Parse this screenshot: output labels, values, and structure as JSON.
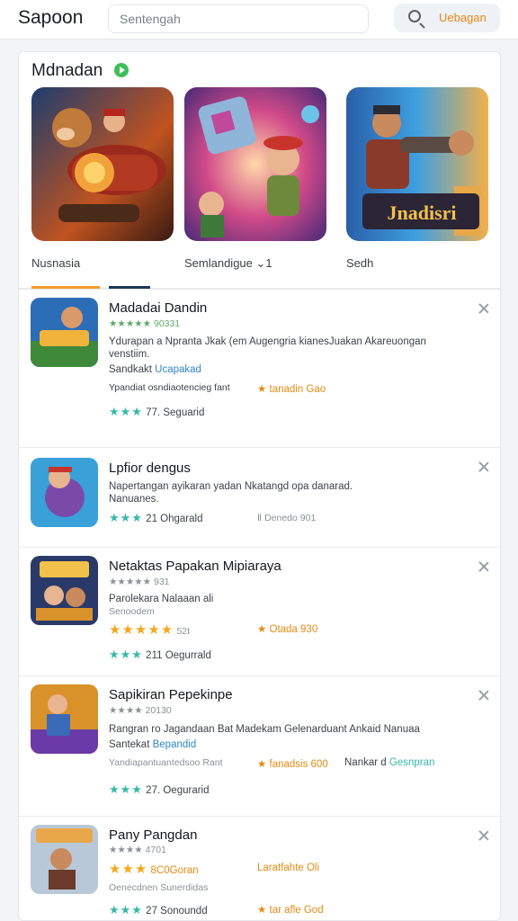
{
  "header": {
    "app_title": "Sapoon",
    "search_placeholder": "Sentengah",
    "search_button": "Uebagan"
  },
  "featured": {
    "title": "Mdnadan",
    "cards": [
      {
        "label": ""
      },
      {
        "label": ""
      },
      {
        "label": "Jnadisri"
      }
    ],
    "tabs": [
      "Nusnasia",
      "Semlandigue ⌄1",
      "Sedh"
    ]
  },
  "list": [
    {
      "name": "Madadai Dandin",
      "rating_line": "★★★★★ 90331",
      "desc_1": "Ydurapan a Npranta Jkak (em Augengria kianesJuakan Akareuongan",
      "desc_2": "venstiim.",
      "sub": "Sandkakt",
      "sub_link": "Ucapakad",
      "meta": "Ypandiat osndiaotencieg fant",
      "badge": "★ tanadin Gao",
      "stars": "★★★",
      "count": "77. Seguarid"
    },
    {
      "name": "Lpfior dengus",
      "desc_1": "Napertangan ayikaran yadan Nkatangd opa danarad.",
      "desc_2": "Nanuanes.",
      "stars": "★★★",
      "count": "21 Ohgarald",
      "extra": "Ⅱ Denedo 901"
    },
    {
      "name": "Netaktas Papakan Mipiaraya",
      "rating_line": "★★★★★ 931",
      "desc_1": "Parolekara Nalaaan ali",
      "desc_2": "Senoodem",
      "big_stars": "★★★★★",
      "big_count": "52t",
      "badge": "★ Otada 930",
      "stars": "★★★",
      "count": "211 Oegurrald"
    },
    {
      "name": "Sapikiran Pepekinpe",
      "rating_line": "★★★★ 20130",
      "desc_1": "Rangran ro Jagandaan Bat Madekam Gelenarduant Ankaid Nanuaa",
      "sub": "Santekat",
      "sub_link": "Bepandid",
      "meta": "Yandiapantuantedsoo Rant",
      "badge": "★ fanadsis 600",
      "meta_2": "Nankar d",
      "meta_link": "Gesnpran",
      "stars": "★★★",
      "count": "27. Oegurarid"
    },
    {
      "name": "Pany Pangdan",
      "rating_line": "★★★★ 4701",
      "big_stars": "★★★",
      "big_count": "8C0Goran",
      "right_text": "Laratfahte Oli",
      "sub": "Oenecdnen Sunerdidas",
      "stars": "★★★",
      "count": "27 Sonoundd",
      "badge": "★ tar afle God"
    }
  ],
  "colors": {
    "accent": "#e58a14",
    "link": "#2f86c9",
    "teal": "#36b9a7",
    "tab_orange": "#f29a2e",
    "tab_navy": "#1b3a57"
  }
}
